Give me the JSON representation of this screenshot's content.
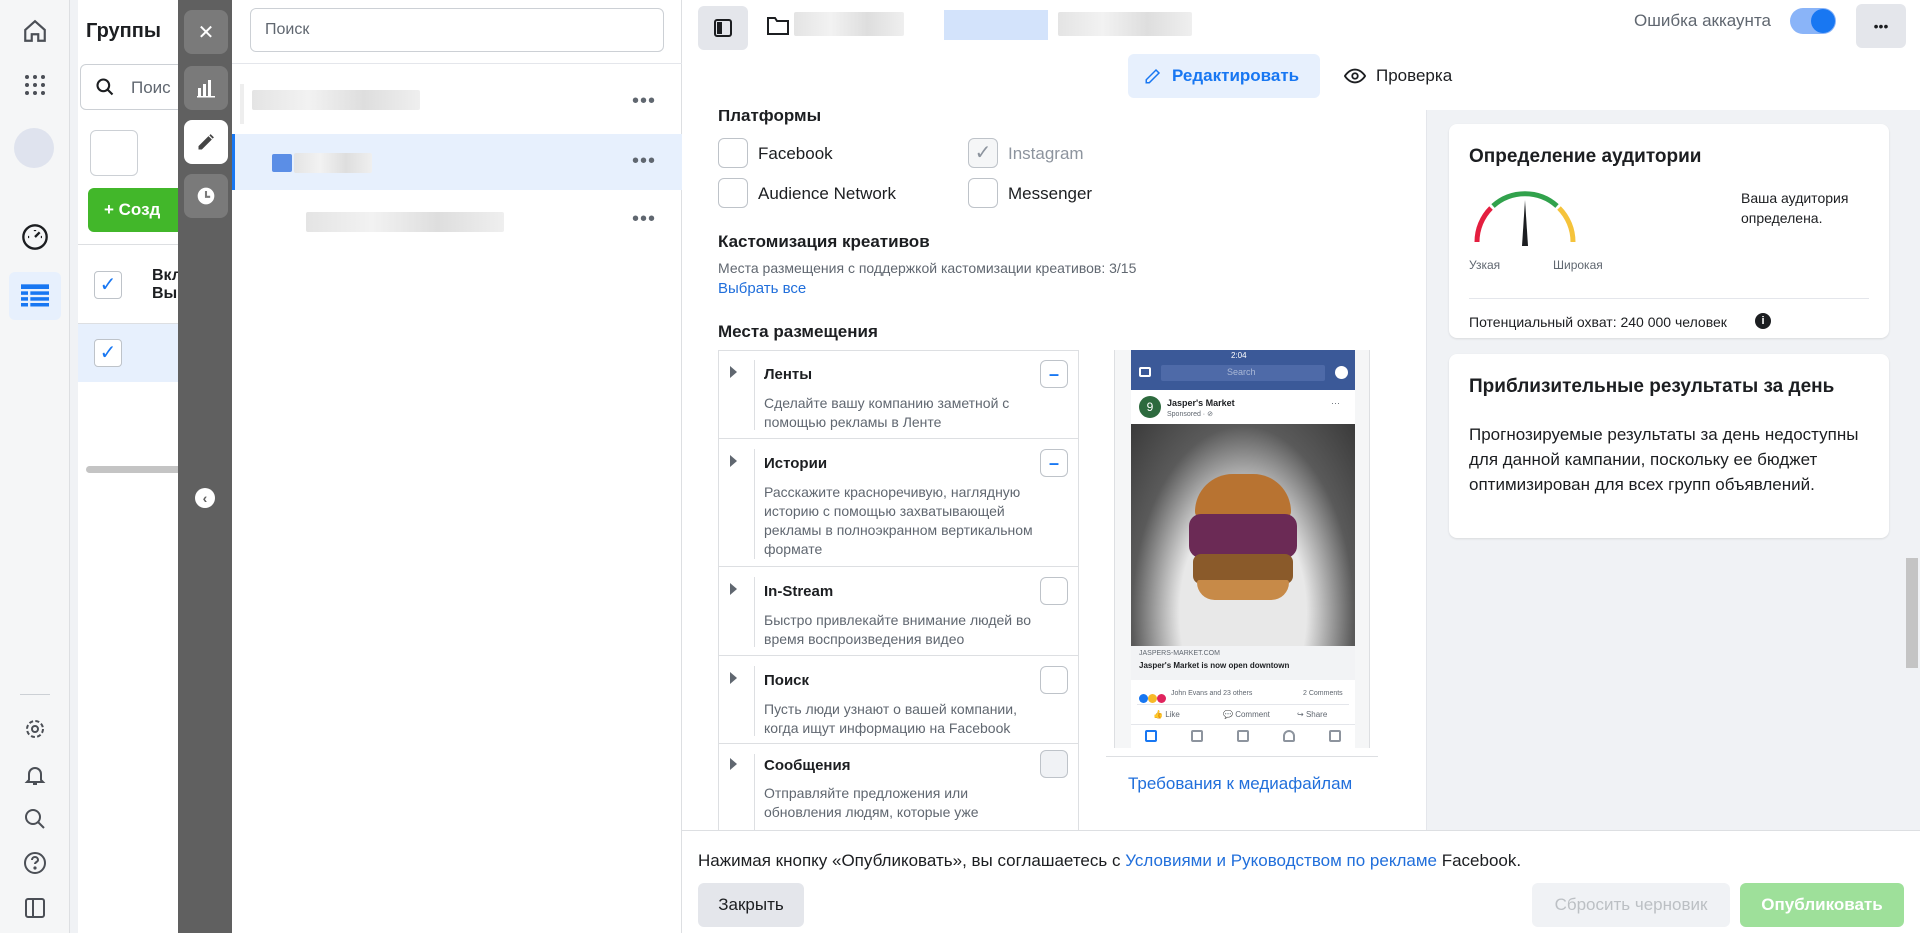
{
  "left_nav": {
    "icons": [
      "home-icon",
      "apps-grid-icon",
      "account-avatar",
      "dashboard-gauge-icon",
      "ads-manager-table-icon",
      "gear-icon",
      "bell-icon",
      "search-icon",
      "help-icon",
      "sidebar-toggle-icon"
    ]
  },
  "underlay": {
    "title": "Группы",
    "search_placeholder": "Поис",
    "create_label": "Созд",
    "col_header": "Вкл\nВы"
  },
  "drawer": {
    "icons": [
      "close-icon",
      "chart-icon",
      "pencil-icon",
      "clock-icon",
      "collapse-chevron-icon"
    ]
  },
  "tree": {
    "search_placeholder": "Поиск",
    "rows": [
      {
        "more": "•••"
      },
      {
        "more": "•••"
      },
      {
        "more": "•••"
      }
    ]
  },
  "header": {
    "account_error_label": "Ошибка аккаунта",
    "toggle_on": true,
    "more": "•••",
    "tab_edit": "Редактировать",
    "tab_review": "Проверка"
  },
  "platforms": {
    "title": "Платформы",
    "items": [
      {
        "label": "Facebook",
        "checked": false
      },
      {
        "label": "Instagram",
        "checked": true
      },
      {
        "label": "Audience Network",
        "checked": false
      },
      {
        "label": "Messenger",
        "checked": false
      }
    ]
  },
  "customization": {
    "title": "Кастомизация креативов",
    "desc": "Места размещения с поддержкой кастомизации креативов: 3/15",
    "select_all": "Выбрать все"
  },
  "placements": {
    "title": "Места размещения",
    "items": [
      {
        "title": "Ленты",
        "desc": "Сделайте вашу компанию заметной с помощью рекламы в Ленте",
        "state": "–"
      },
      {
        "title": "Истории",
        "desc": "Расскажите красноречивую, наглядную историю с помощью захватывающей рекламы в полноэкранном вертикальном формате",
        "state": "–"
      },
      {
        "title": "In-Stream",
        "desc": "Быстро привлекайте внимание людей во время воспроизведения видео",
        "state": ""
      },
      {
        "title": "Поиск",
        "desc": "Пусть люди узнают о вашей компании, когда ищут информацию на Facebook",
        "state": ""
      },
      {
        "title": "Сообщения",
        "desc": "Отправляйте предложения или обновления людям, которые уже",
        "state": ""
      }
    ]
  },
  "preview": {
    "time": "2:04",
    "search": "Search",
    "page_name": "Jasper's Market",
    "sponsored": "Sponsored · ⊘",
    "domain": "JASPERS-MARKET.COM",
    "headline": "Jasper's Market is now open downtown",
    "reactions": "John Evans and 23 others",
    "comments": "2 Comments",
    "like": "Like",
    "comment": "Comment",
    "share": "Share",
    "media_link": "Требования к медиафайлам",
    "colors": {
      "fb_blue": "#3b5998",
      "bun": "#b87331",
      "cabbage": "#6b2a55"
    }
  },
  "audience": {
    "title": "Определение аудитории",
    "status": "Ваша аудитория определена.",
    "narrow": "Узкая",
    "wide": "Широкая",
    "reach_label": "Потенциальный охват: 240 000 человек"
  },
  "estimates": {
    "title": "Приблизительные результаты за день",
    "text": "Прогнозируемые результаты за день недоступны для данной кампании, поскольку ее бюджет оптимизирован для всех групп объявлений."
  },
  "footer": {
    "consent_prefix": "Нажимая кнопку «Опубликовать», вы соглашаетесь с ",
    "consent_link": "Условиями и Руководством по рекламе",
    "consent_suffix": " Facebook.",
    "close": "Закрыть",
    "reset": "Сбросить черновик",
    "publish": "Опубликовать"
  },
  "colors": {
    "primary": "#1877f2",
    "green": "#42b72a",
    "publish_disabled": "#9ee09a"
  }
}
